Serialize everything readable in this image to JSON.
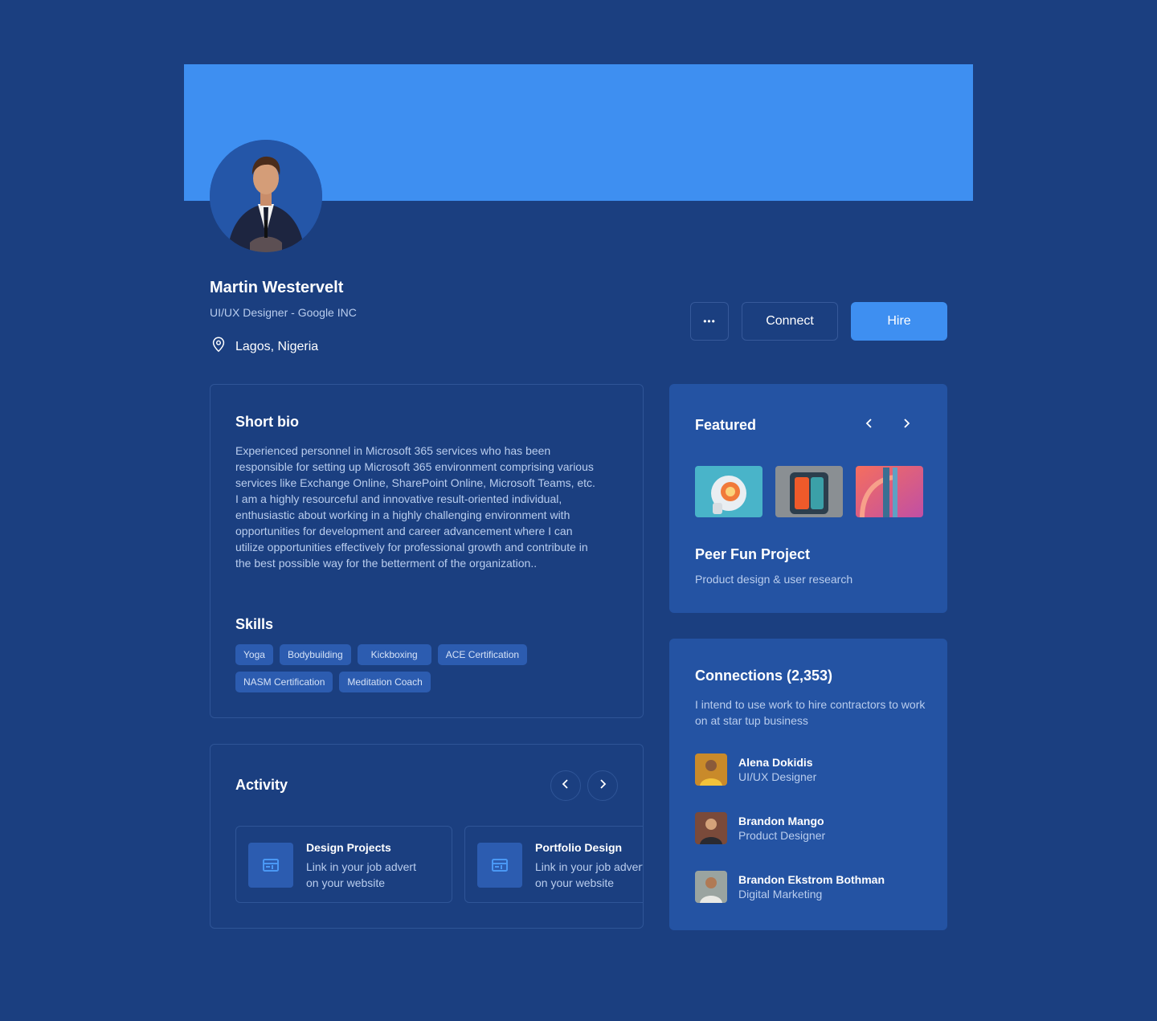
{
  "profile": {
    "name": "Martin Westervelt",
    "role": "UI/UX Designer - Google INC",
    "location": "Lagos, Nigeria"
  },
  "actions": {
    "more_label": "•••",
    "connect_label": "Connect",
    "hire_label": "Hire"
  },
  "bio": {
    "title": "Short bio",
    "text": "Experienced personnel in Microsoft 365 services who has been responsible for setting up Microsoft 365 environment comprising various services like Exchange Online, SharePoint Online, Microsoft Teams, etc. I am a highly resourceful and innovative result-oriented individual, enthusiastic about working in a highly challenging environment with opportunities for development and career advancement where I can utilize opportunities effectively for professional growth and contribute in the best possible way for the betterment of the organization.."
  },
  "skills": {
    "title": "Skills",
    "items": [
      "Yoga",
      "Bodybuilding",
      "Kickboxing",
      "ACE Certification",
      "NASM Certification",
      "Meditation Coach"
    ]
  },
  "activity": {
    "title": "Activity",
    "items": [
      {
        "title": "Design Projects",
        "line1": "Link in your job advert",
        "line2": "on your website"
      },
      {
        "title": "Portfolio Design",
        "line1": "Link in your job advert",
        "line2": "on your website"
      }
    ]
  },
  "featured": {
    "title": "Featured",
    "project_name": "Peer Fun Project",
    "project_desc": "Product design & user research"
  },
  "connections": {
    "title": "Connections (2,353)",
    "desc": "I intend to use work to hire contractors to work on at star tup business",
    "people": [
      {
        "name": "Alena Dokidis",
        "role": "UI/UX Designer"
      },
      {
        "name": "Brandon Mango",
        "role": "Product Designer"
      },
      {
        "name": "Brandon Ekstrom Bothman",
        "role": "Digital Marketing"
      }
    ]
  },
  "colors": {
    "background": "#1b3f80",
    "banner": "#3e8ff1",
    "card": "#2453a3",
    "muted_text": "#b9cdee"
  }
}
